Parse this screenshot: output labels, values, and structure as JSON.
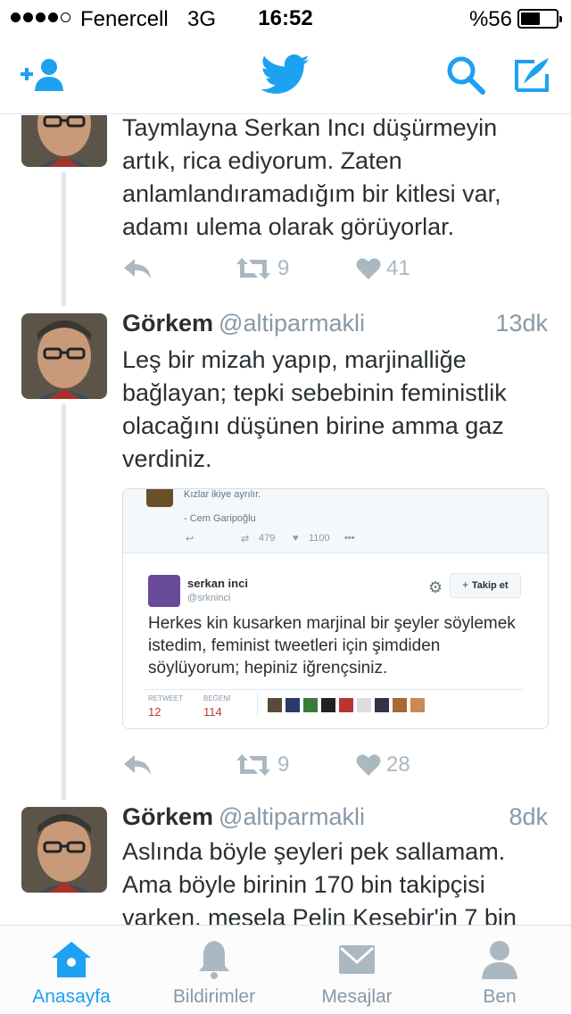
{
  "status_bar": {
    "signal_dots_filled": 4,
    "signal_dots_total": 5,
    "carrier": "Fenercell",
    "network": "3G",
    "time": "16:52",
    "battery_percent_text": "%56",
    "battery_level": 0.56
  },
  "nav": {
    "add_user_icon": "add-user-icon",
    "logo_icon": "twitter-bird-icon",
    "search_icon": "search-icon",
    "compose_icon": "compose-icon"
  },
  "colors": {
    "accent": "#1da1f2",
    "text": "#292f33",
    "muted": "#8899a6",
    "icon_gray": "#aab8c2",
    "retweet_like_red": "#e0245e"
  },
  "tweets": [
    {
      "text": "Taymlayna Serkan Incı düşürmeyin artık, rica ediyorum. Zaten anlamlandıramadığım bir kitlesi var, adamı ulema olarak görüyorlar.",
      "retweets": "9",
      "likes": "41"
    },
    {
      "name": "Görkem",
      "handle": "@altiparmakli",
      "time": "13dk",
      "text": "Leş bir mizah yapıp, marjinalliğe bağlayan; tepki sebebinin feministlik olacağını düşünen birine amma gaz verdiniz.",
      "retweets": "9",
      "likes": "28",
      "embed": {
        "top_text": "Kızlar ikiye ayrılır.",
        "top_author": "- Cem Garipoğlu",
        "top_retweets": "479",
        "top_likes": "1100",
        "top_more": "•••",
        "name": "serkan inci",
        "handle": "@srkninci",
        "follow_label": "Takip et",
        "text": "Herkes kin kusarken marjinal bir şeyler söylemek istedim, feminist tweetleri için şimdiden söylüyorum; hepiniz iğrençsiniz.",
        "retweet_label": "RETWEET",
        "retweet_count": "12",
        "like_label": "BEĞENİ",
        "like_count": "114"
      }
    },
    {
      "name": "Görkem",
      "handle": "@altiparmakli",
      "time": "8dk",
      "text": "Aslında böyle şeyleri pek sallamam. Ama böyle birinin 170 bin takipçisi varken, mesela Pelin Kesebir'in 7 bin"
    }
  ],
  "tabs": [
    {
      "label": "Anasayfa",
      "icon": "home-icon",
      "active": true
    },
    {
      "label": "Bildirimler",
      "icon": "bell-icon",
      "active": false
    },
    {
      "label": "Mesajlar",
      "icon": "envelope-icon",
      "active": false
    },
    {
      "label": "Ben",
      "icon": "person-icon",
      "active": false
    }
  ]
}
